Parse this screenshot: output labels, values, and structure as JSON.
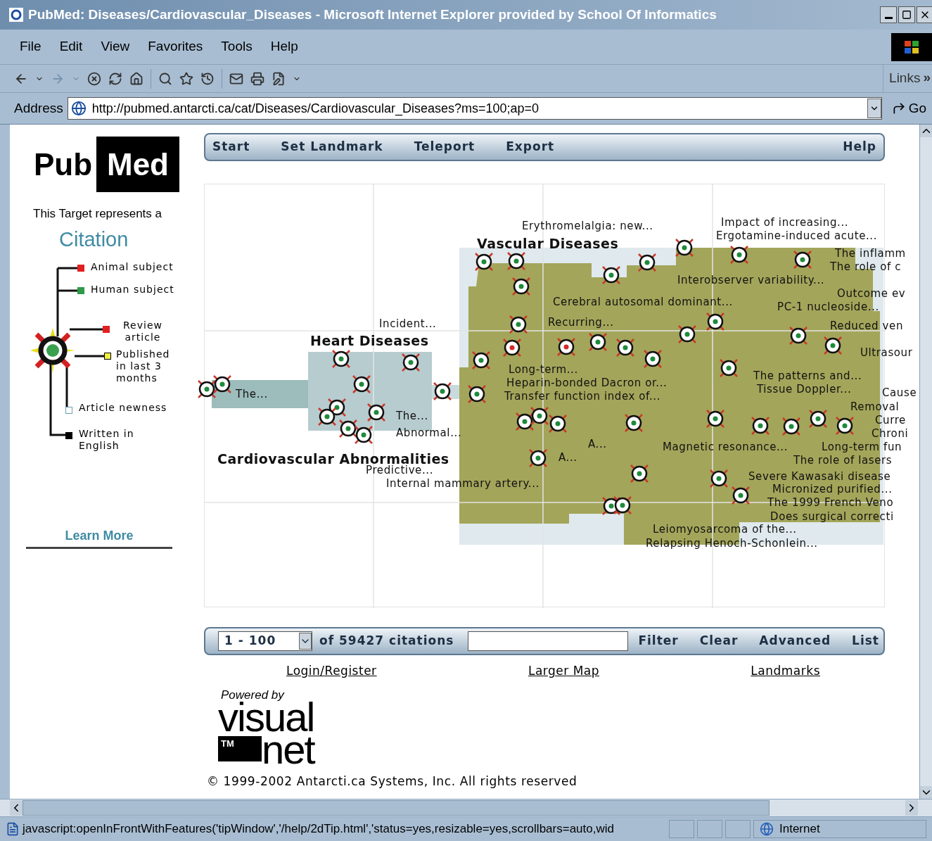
{
  "window": {
    "title": "PubMed: Diseases/Cardiovascular_Diseases - Microsoft Internet Explorer provided by School Of Informatics"
  },
  "menu": [
    "File",
    "Edit",
    "View",
    "Favorites",
    "Tools",
    "Help"
  ],
  "toolbar": {
    "links_label": "Links",
    "links_more": "»"
  },
  "address": {
    "label": "Address",
    "url": "http://pubmed.antarcti.ca/cat/Diseases/Cardiovascular_Diseases?ms=100;ap=0",
    "go": "Go"
  },
  "sidebar": {
    "logo": [
      "Pub",
      "Med"
    ],
    "intro": "This Target represents a",
    "heading": "Citation",
    "legend": [
      {
        "label": "Animal subject",
        "color": "#e02020",
        "kind": "filled"
      },
      {
        "label": "Human subject",
        "color": "#2e9a48",
        "kind": "filled"
      },
      {
        "label": "Review article",
        "color": "#e02020",
        "kind": "filled"
      },
      {
        "label": "Published in last 3 months",
        "color": "#f0f040",
        "kind": "bordered"
      },
      {
        "label": "Article newness",
        "color": "#6aa0b4",
        "kind": "outlined"
      },
      {
        "label": "Written in English",
        "color": "#000000",
        "kind": "filled"
      }
    ],
    "learn_more": "Learn More"
  },
  "nav": [
    "Start",
    "Set Landmark",
    "Teleport",
    "Export",
    "Help"
  ],
  "map": {
    "regions": [
      {
        "title": "Vascular Diseases"
      },
      {
        "title": "Heart Diseases"
      },
      {
        "title": "Cardiovascular Abnormalities"
      }
    ],
    "labels": [
      "Erythromelalgia: new...",
      "Impact of increasing...",
      "Ergotamine-induced acute...",
      "The inflamm",
      "The role of c",
      "Interobserver variability...",
      "Outcome ev",
      "Cerebral autosomal dominant...",
      "PC-1 nucleoside...",
      "Incident...",
      "Recurring...",
      "Reduced ven",
      "Ultrasour",
      "Long-term...",
      "The patterns and...",
      "Heparin-bonded Dacron or...",
      "The...",
      "Transfer function index of...",
      "Tissue Doppler...",
      "Cause",
      "Removal",
      "The...",
      "Curre",
      "Abnormal...",
      "Chroni",
      "A...",
      "Magnetic resonance...",
      "Long-term fun",
      "A...",
      "The role of lasers",
      "Predictive...",
      "Severe Kawasaki disease",
      "Internal mammary artery...",
      "Micronized purified...",
      "The 1999 French Veno",
      "Does surgical correcti",
      "Leiomyosarcoma of the...",
      "Relapsing Henoch-Schonlein..."
    ],
    "targets": [
      {
        "color": "#1e8a3c"
      },
      {
        "color": "#1e8a3c"
      },
      {
        "color": "#1e8a3c"
      },
      {
        "color": "#1e8a3c"
      },
      {
        "color": "#1e8a3c"
      },
      {
        "color": "#1e8a3c"
      },
      {
        "color": "#1e8a3c"
      },
      {
        "color": "#1e8a3c"
      },
      {
        "color": "#1e8a3c"
      },
      {
        "color": "#d42a2a"
      },
      {
        "color": "#d42a2a"
      },
      {
        "color": "#1e8a3c"
      },
      {
        "color": "#1e8a3c"
      },
      {
        "color": "#1e8a3c"
      },
      {
        "color": "#1e8a3c"
      },
      {
        "color": "#1e8a3c"
      },
      {
        "color": "#1e8a3c"
      },
      {
        "color": "#1e8a3c"
      },
      {
        "color": "#1e8a3c"
      },
      {
        "color": "#1e8a3c"
      },
      {
        "color": "#1e8a3c"
      },
      {
        "color": "#1e8a3c"
      },
      {
        "color": "#1e8a3c"
      },
      {
        "color": "#1e8a3c"
      },
      {
        "color": "#1e8a3c"
      },
      {
        "color": "#1e8a3c"
      },
      {
        "color": "#1e8a3c"
      },
      {
        "color": "#1e8a3c"
      },
      {
        "color": "#1e8a3c"
      },
      {
        "color": "#1e8a3c"
      },
      {
        "color": "#1e8a3c"
      },
      {
        "color": "#1e8a3c"
      },
      {
        "color": "#1e8a3c"
      },
      {
        "color": "#1e8a3c"
      },
      {
        "color": "#1e8a3c"
      },
      {
        "color": "#1e8a3c"
      },
      {
        "color": "#1e8a3c"
      },
      {
        "color": "#1e8a3c"
      },
      {
        "color": "#1e8a3c"
      },
      {
        "color": "#1e8a3c"
      },
      {
        "color": "#1e8a3c"
      },
      {
        "color": "#1e8a3c"
      },
      {
        "color": "#1e8a3c"
      },
      {
        "color": "#1e8a3c"
      },
      {
        "color": "#1e8a3c"
      },
      {
        "color": "#1e8a3c"
      },
      {
        "color": "#1e8a3c"
      }
    ]
  },
  "results": {
    "range": "1 - 100",
    "count": "of 59427 citations",
    "buttons": [
      "Filter",
      "Clear",
      "Advanced",
      "List"
    ]
  },
  "links": [
    "Login/Register",
    "Larger Map",
    "Landmarks"
  ],
  "powered_by": {
    "caption": "Powered by",
    "word1": "visual",
    "mark": "TM",
    "word2": "net"
  },
  "copyright": "© 1999-2002 Antarcti.ca Systems, Inc. All rights reserved",
  "status_bar": {
    "text": "javascript:openInFrontWithFeatures('tipWindow','/help/2dTip.html','status=yes,resizable=yes,scrollbars=auto,wid",
    "zone": "Internet"
  }
}
